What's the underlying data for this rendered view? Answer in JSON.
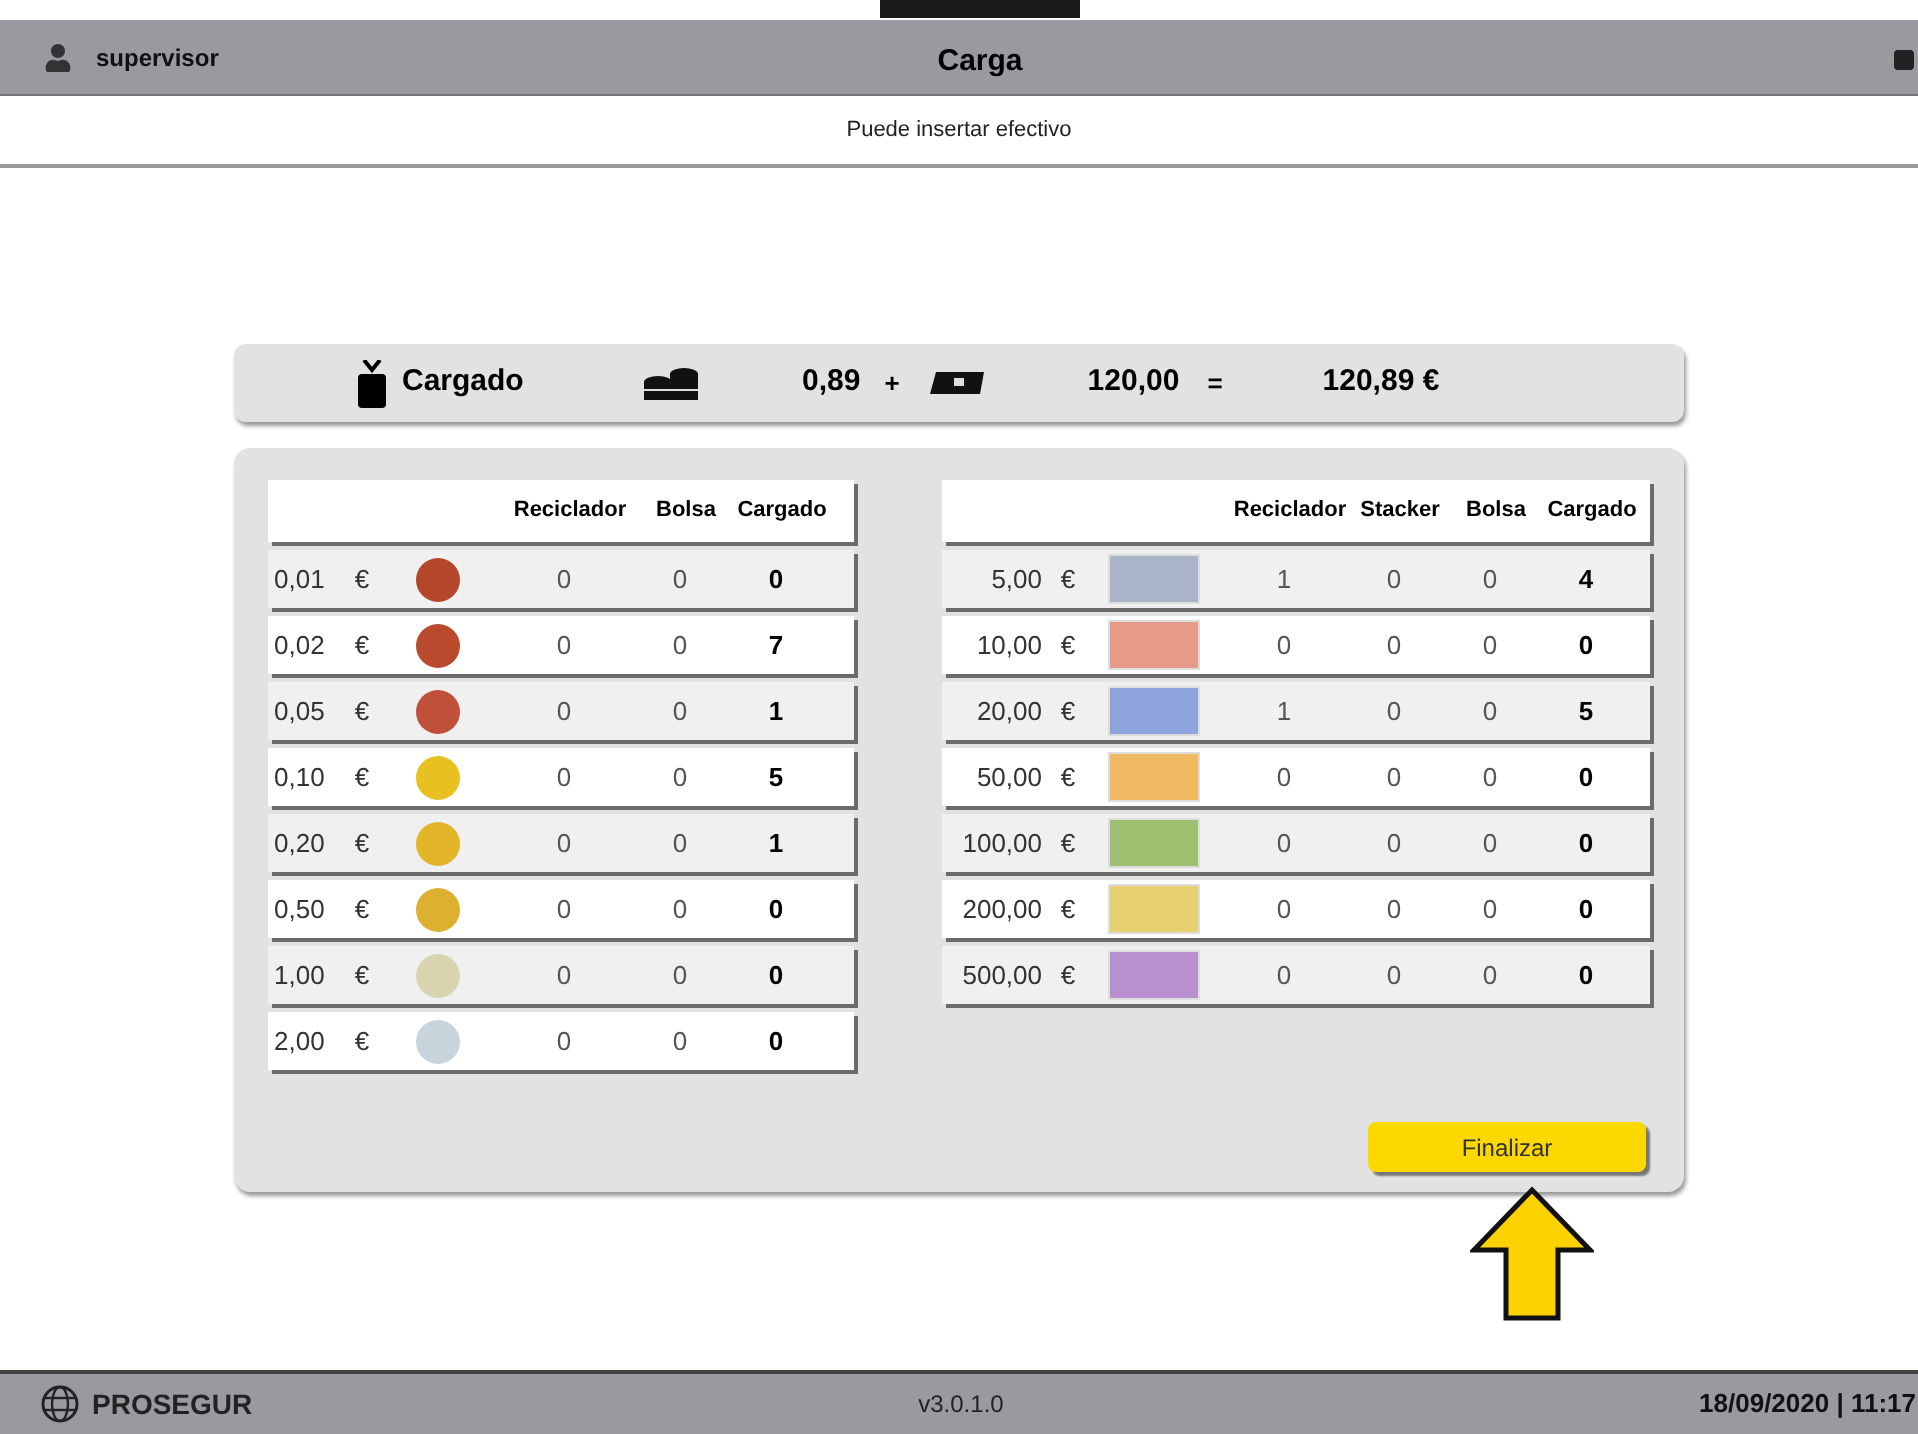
{
  "header": {
    "user": "supervisor",
    "title": "Carga"
  },
  "message": "Puede insertar efectivo",
  "summary": {
    "label": "Cargado",
    "coins_total": "0,89",
    "plus": "+",
    "notes_total": "120,00",
    "equals": "=",
    "grand_total": "120,89 €"
  },
  "coins": {
    "columns": [
      "Reciclador",
      "Bolsa",
      "Cargado"
    ],
    "rows": [
      {
        "value": "0,01",
        "currency": "€",
        "color": "#b4472a",
        "recycler": "0",
        "bag": "0",
        "loaded": "0"
      },
      {
        "value": "0,02",
        "currency": "€",
        "color": "#b94a2e",
        "recycler": "0",
        "bag": "0",
        "loaded": "7"
      },
      {
        "value": "0,05",
        "currency": "€",
        "color": "#c0503a",
        "recycler": "0",
        "bag": "0",
        "loaded": "1"
      },
      {
        "value": "0,10",
        "currency": "€",
        "color": "#e8c020",
        "recycler": "0",
        "bag": "0",
        "loaded": "5"
      },
      {
        "value": "0,20",
        "currency": "€",
        "color": "#e2b428",
        "recycler": "0",
        "bag": "0",
        "loaded": "1"
      },
      {
        "value": "0,50",
        "currency": "€",
        "color": "#deb030",
        "recycler": "0",
        "bag": "0",
        "loaded": "0"
      },
      {
        "value": "1,00",
        "currency": "€",
        "color": "#d8d4b0",
        "recycler": "0",
        "bag": "0",
        "loaded": "0"
      },
      {
        "value": "2,00",
        "currency": "€",
        "color": "#c8d4dc",
        "recycler": "0",
        "bag": "0",
        "loaded": "0"
      }
    ]
  },
  "notes": {
    "columns": [
      "Reciclador",
      "Stacker",
      "Bolsa",
      "Cargado"
    ],
    "rows": [
      {
        "value": "5,00",
        "currency": "€",
        "color": "#a9b4c8",
        "recycler": "1",
        "stacker": "0",
        "bag": "0",
        "loaded": "4"
      },
      {
        "value": "10,00",
        "currency": "€",
        "color": "#e89a88",
        "recycler": "0",
        "stacker": "0",
        "bag": "0",
        "loaded": "0"
      },
      {
        "value": "20,00",
        "currency": "€",
        "color": "#8ea4dc",
        "recycler": "1",
        "stacker": "0",
        "bag": "0",
        "loaded": "5"
      },
      {
        "value": "50,00",
        "currency": "€",
        "color": "#f0b860",
        "recycler": "0",
        "stacker": "0",
        "bag": "0",
        "loaded": "0"
      },
      {
        "value": "100,00",
        "currency": "€",
        "color": "#9cc070",
        "recycler": "0",
        "stacker": "0",
        "bag": "0",
        "loaded": "0"
      },
      {
        "value": "200,00",
        "currency": "€",
        "color": "#e8d070",
        "recycler": "0",
        "stacker": "0",
        "bag": "0",
        "loaded": "0"
      },
      {
        "value": "500,00",
        "currency": "€",
        "color": "#b890d0",
        "recycler": "0",
        "stacker": "0",
        "bag": "0",
        "loaded": "0"
      }
    ]
  },
  "finish_button": "Finalizar",
  "footer": {
    "brand": "PROSEGUR",
    "version": "v3.0.1.0",
    "datetime": "18/09/2020 | 11:17"
  }
}
